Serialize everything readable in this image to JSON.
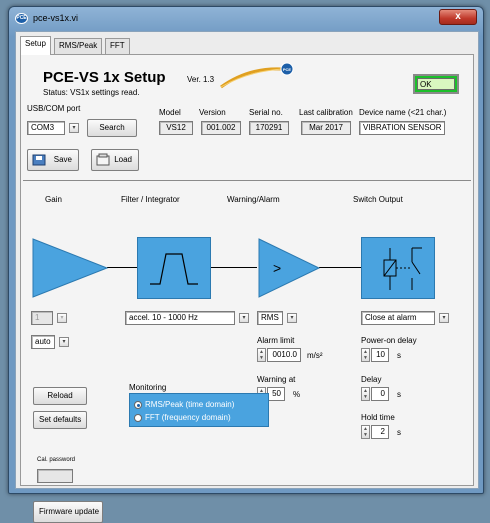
{
  "window": {
    "title": "pce-vs1x.vi",
    "close_symbol": "x",
    "app_icon_text": "PCE"
  },
  "tabs": [
    {
      "label": "Setup",
      "active": true
    },
    {
      "label": "RMS/Peak",
      "active": false
    },
    {
      "label": "FFT",
      "active": false
    }
  ],
  "header": {
    "title": "PCE-VS 1x Setup",
    "version": "Ver. 1.3",
    "status": "Status:  VS1x settings read.",
    "ok_label": "OK",
    "ok_color": "#1bbf2a",
    "logo_text": "PCE"
  },
  "device": {
    "port_label": "USB/COM port",
    "port_value": "COM3",
    "search_label": "Search",
    "model_label": "Model",
    "model_value": "VS12",
    "version_label": "Version",
    "version_value": "001.002",
    "serial_label": "Serial no.",
    "serial_value": "170291",
    "calibration_label": "Last calibration",
    "calibration_value": "Mar 2017",
    "name_label": "Device name (<21 char.)",
    "name_value": "VIBRATION SENSOR",
    "save_label": "Save",
    "load_label": "Load"
  },
  "blocks": {
    "gain": "Gain",
    "filter": "Filter / Integrator",
    "warning": "Warning/Alarm",
    "switch": "Switch Output",
    "block_color": "#4aa3df"
  },
  "controls": {
    "gain_value": "1",
    "gain_mode": "auto",
    "filter_value": "accel. 10 - 1000 Hz",
    "alarm_mode": "RMS",
    "alarm_limit_label": "Alarm limit",
    "alarm_limit_value": "0010.0",
    "alarm_limit_unit": "m/s²",
    "warning_at_label": "Warning at",
    "warning_at_value": "50",
    "warning_at_unit": "%",
    "switch_mode": "Close at alarm",
    "power_on_delay_label": "Power-on delay",
    "power_on_delay_value": "10",
    "delay_label": "Delay",
    "delay_value": "0",
    "hold_time_label": "Hold time",
    "hold_time_value": "2",
    "seconds_unit": "s"
  },
  "monitoring": {
    "label": "Monitoring",
    "option_time": "RMS/Peak (time domain)",
    "option_fft": "FFT (frequency domain)",
    "selected": "time"
  },
  "actions": {
    "reload_label": "Reload",
    "defaults_label": "Set defaults",
    "cal_password_label": "Cal. password",
    "firmware_label": "Firmware update"
  }
}
